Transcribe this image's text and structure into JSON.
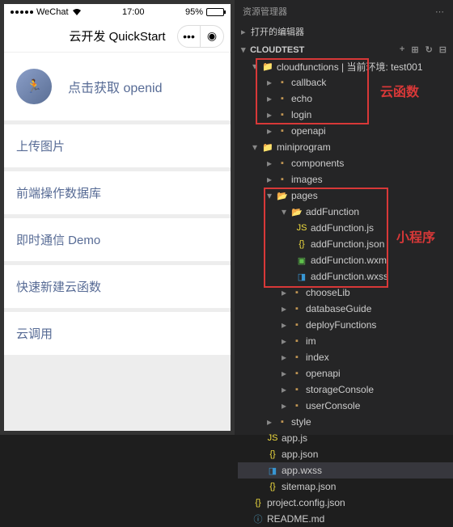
{
  "phone": {
    "statusbar": {
      "carrier": "WeChat",
      "time": "17:00",
      "battery": "95%"
    },
    "navbar": {
      "title": "云开发 QuickStart"
    },
    "header": {
      "openid_btn": "点击获取 openid"
    },
    "menu": [
      "上传图片",
      "前端操作数据库",
      "即时通信 Demo",
      "快速新建云函数",
      "云调用"
    ]
  },
  "explorer": {
    "panel_title": "资源管理器",
    "section_open_editors": "打开的编辑器",
    "project_name": "CLOUDTEST",
    "tree": {
      "cloudfunctions": {
        "label": "cloudfunctions | 当前环境: test001",
        "children": [
          "callback",
          "echo",
          "login",
          "openapi"
        ]
      },
      "miniprogram": {
        "label": "miniprogram",
        "components": "components",
        "images": "images",
        "pages": {
          "label": "pages",
          "addFunction": {
            "label": "addFunction",
            "files": [
              "addFunction.js",
              "addFunction.json",
              "addFunction.wxml",
              "addFunction.wxss"
            ]
          },
          "others": [
            "chooseLib",
            "databaseGuide",
            "deployFunctions",
            "im",
            "index",
            "openapi",
            "storageConsole",
            "userConsole"
          ]
        },
        "style": "style",
        "rootfiles": [
          "app.js",
          "app.json",
          "app.wxss",
          "sitemap.json"
        ]
      },
      "project_config": "project.config.json",
      "readme": "README.md"
    }
  },
  "annotations": {
    "cloud_functions": "云函数",
    "miniprogram": "小程序"
  }
}
